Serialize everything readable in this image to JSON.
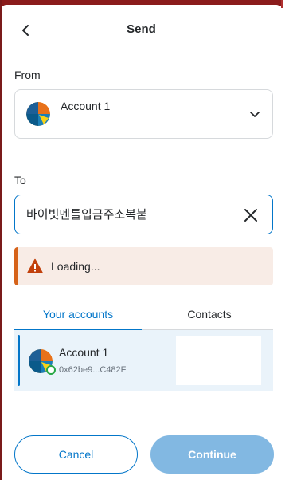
{
  "header": {
    "title": "Send"
  },
  "from": {
    "label": "From",
    "account_name": "Account 1"
  },
  "to": {
    "label": "To",
    "input_value": "바이빗멘틀입금주소복붙"
  },
  "status": {
    "text": "Loading..."
  },
  "tabs": [
    {
      "label": "Your accounts",
      "active": true
    },
    {
      "label": "Contacts",
      "active": false
    }
  ],
  "accounts": [
    {
      "name": "Account 1",
      "address": "0x62be9...C482F"
    }
  ],
  "buttons": {
    "cancel_label": "Cancel",
    "continue_label": "Continue"
  },
  "colors": {
    "accent": "#0376c9",
    "warning": "#d6631a",
    "warning_bg": "#f8ece6",
    "selected_row_bg": "#eaf3fa",
    "continue_disabled": "#82b8e2"
  },
  "icons": [
    "chevron-left-icon",
    "chevron-down-icon",
    "close-icon",
    "warning-icon",
    "account-avatar-icon"
  ]
}
